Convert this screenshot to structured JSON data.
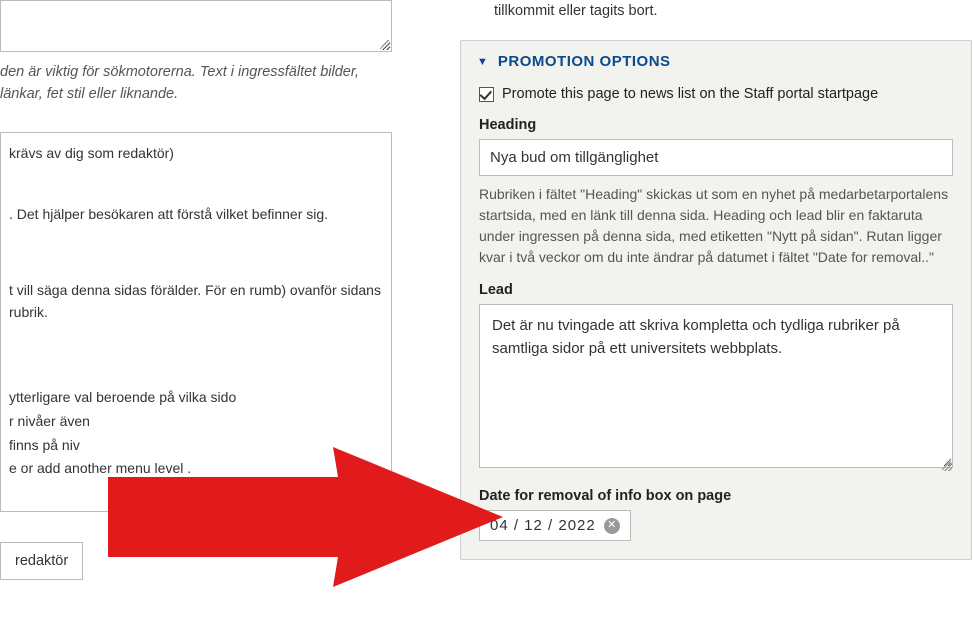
{
  "left": {
    "help_ingress": "den är viktig för sökmotorerna. Text i ingressfältet bilder, länkar, fet stil eller liknande.",
    "editor_req": "krävs av dig som redaktör)",
    "help_context": ". Det hjälper besökaren att förstå vilket befinner sig.",
    "parent_text": "t vill säga denna sidas förälder. För en rumb) ovanför sidans rubrik.",
    "menu_text_1": "ytterligare val beroende på vilka sido",
    "menu_text_2": "r nivåer även",
    "menu_text_3": "finns på niv",
    "menu_text_4": "e or add another menu level .",
    "editor_label": "redaktör"
  },
  "right": {
    "top_fragment": "tillkommit eller tagits bort.",
    "section_title": "PROMOTION OPTIONS",
    "promote_label": "Promote this page to news list on the Staff portal startpage",
    "heading_label": "Heading",
    "heading_value": "Nya bud om tillgänglighet",
    "heading_desc": "Rubriken i fältet \"Heading\" skickas ut som en nyhet på medarbetarportalens startsida, med en länk till denna sida. Heading och lead blir en faktaruta under ingressen på denna sida, med etiketten \"Nytt på sidan\". Rutan ligger kvar i två veckor om du inte ändrar på datumet i fältet \"Date for removal..\"",
    "lead_label": "Lead",
    "lead_value": "Det är nu tvingade att skriva kompletta och tydliga rubriker på samtliga sidor på ett universitets webbplats.",
    "date_label": "Date for removal of info box on page",
    "date_value": "04 / 12 / 2022"
  },
  "colors": {
    "accent": "#0a4a8a",
    "arrow": "#e11b1b"
  }
}
